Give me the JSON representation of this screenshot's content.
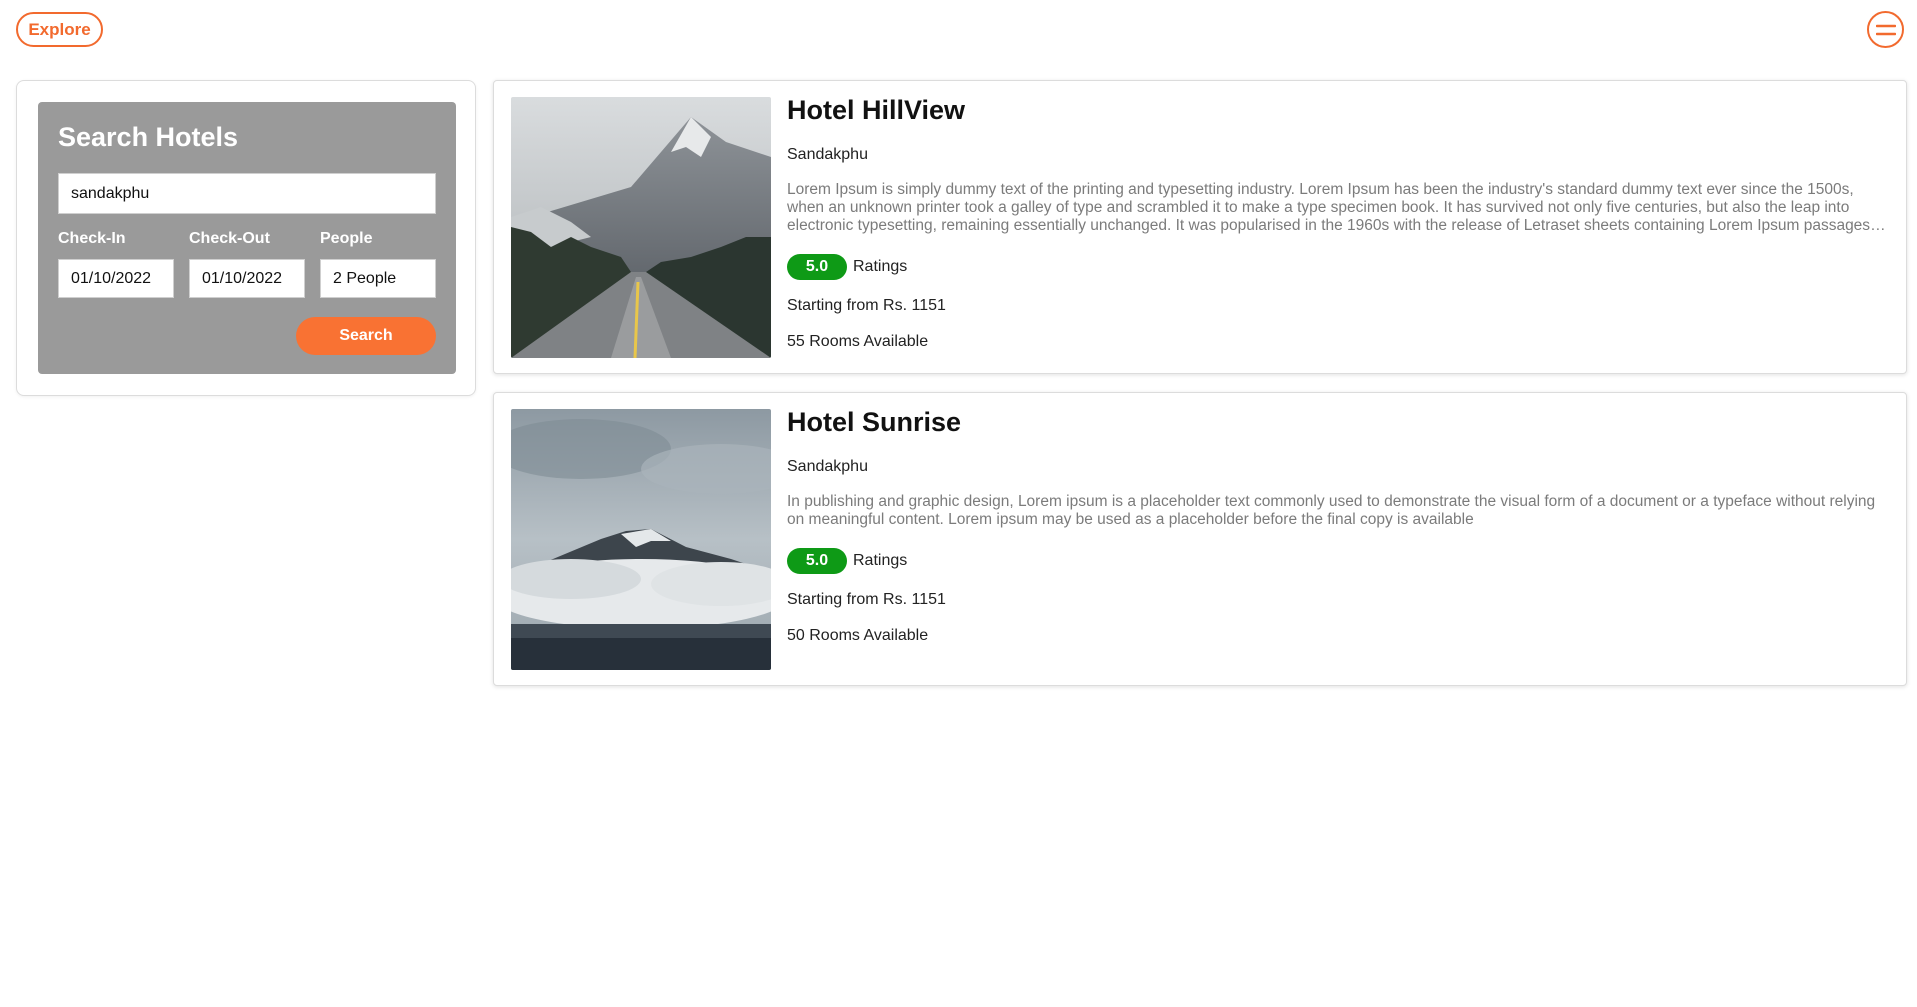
{
  "header": {
    "explore_label": "Explore",
    "menu_icon": "menu-icon"
  },
  "search": {
    "title": "Search Hotels",
    "location_value": "sandakphu",
    "checkin_label": "Check-In",
    "checkin_value": "01/10/2022",
    "checkout_label": "Check-Out",
    "checkout_value": "01/10/2022",
    "people_label": "People",
    "people_value": "2 People",
    "search_label": "Search"
  },
  "hotels": [
    {
      "name": "Hotel HillView",
      "location": "Sandakphu",
      "description": "Lorem Ipsum is simply dummy text of the printing and typesetting industry. Lorem Ipsum has been the industry's standard dummy text ever since the 1500s, when an unknown printer took a galley of type and scrambled it to make a type specimen book. It has survived not only five centuries, but also the leap into electronic typesetting, remaining essentially unchanged. It was popularised in the 1960s with the release of Letraset sheets containing Lorem Ipsum passages, and more recently with desktop publishing software like Aldus PageMaker including versions of Lorem Ipsum.",
      "rating": "5.0",
      "rating_label": "Ratings",
      "price": "Starting from Rs. 1151",
      "rooms": "55 Rooms Available",
      "image": "mountain-road-photo"
    },
    {
      "name": "Hotel Sunrise",
      "location": "Sandakphu",
      "description": "In publishing and graphic design, Lorem ipsum is a placeholder text commonly used to demonstrate the visual form of a document or a typeface without relying on meaningful content. Lorem ipsum may be used as a placeholder before the final copy is available",
      "rating": "5.0",
      "rating_label": "Ratings",
      "price": "Starting from Rs. 1151",
      "rooms": "50 Rooms Available",
      "image": "cloudy-mountain-photo"
    }
  ],
  "colors": {
    "accent": "#f26a2e",
    "search_button": "#f97233",
    "panel_bg": "#9a9a9a",
    "rating_green": "#0e9a16"
  }
}
